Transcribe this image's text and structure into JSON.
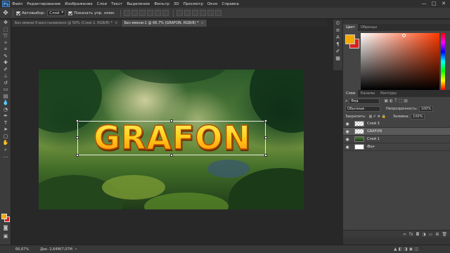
{
  "menu": {
    "logo": "Ps",
    "items": [
      "Файл",
      "Редактирование",
      "Изображение",
      "Слои",
      "Текст",
      "Выделение",
      "Фильтр",
      "3D",
      "Просмотр",
      "Окно",
      "Справка"
    ],
    "window_controls": [
      "—",
      "□",
      "✕"
    ]
  },
  "options_bar": {
    "autoselect_label": "Автовыбор:",
    "autoselect_value": "Слой",
    "show_controls_label": "Показать упр. элем."
  },
  "tabs": [
    {
      "label": "Без имени-5-восстановлено @ 50% (Слой 2, RGB/8) *",
      "close": "×",
      "active": false
    },
    {
      "label": "Без имени-1 @ 66,7% (GRAFON, RGB/8) *",
      "close": "×",
      "active": true
    }
  ],
  "canvas": {
    "title_text": "GRAFON"
  },
  "status": {
    "zoom": "66,67%",
    "doc_info": "Док: 2,64M/7,07M"
  },
  "color_panel": {
    "tabs": [
      "Цвет",
      "Образцы"
    ],
    "fg_color": "#f5a800",
    "bg_color": "#d8201f"
  },
  "layers_panel": {
    "tabs": [
      "Слои",
      "Каналы",
      "Контуры"
    ],
    "filter_label": "Вид",
    "blend_mode": "Обычные",
    "opacity_label": "Непрозрачность:",
    "opacity_value": "100%",
    "lock_label": "Закрепить:",
    "fill_label": "Заливка:",
    "fill_value": "100%",
    "layers": [
      {
        "name": "Слой 3",
        "selected": false,
        "thumb": "checker"
      },
      {
        "name": "GRAFON",
        "selected": true,
        "thumb": "checker"
      },
      {
        "name": "Слой 1",
        "selected": false,
        "thumb": "forest"
      },
      {
        "name": "Фон",
        "selected": false,
        "thumb": "white"
      }
    ]
  },
  "colors": {
    "accent_orange": "#f5a800",
    "accent_red": "#d8201f",
    "chrome_dark": "#282828"
  }
}
